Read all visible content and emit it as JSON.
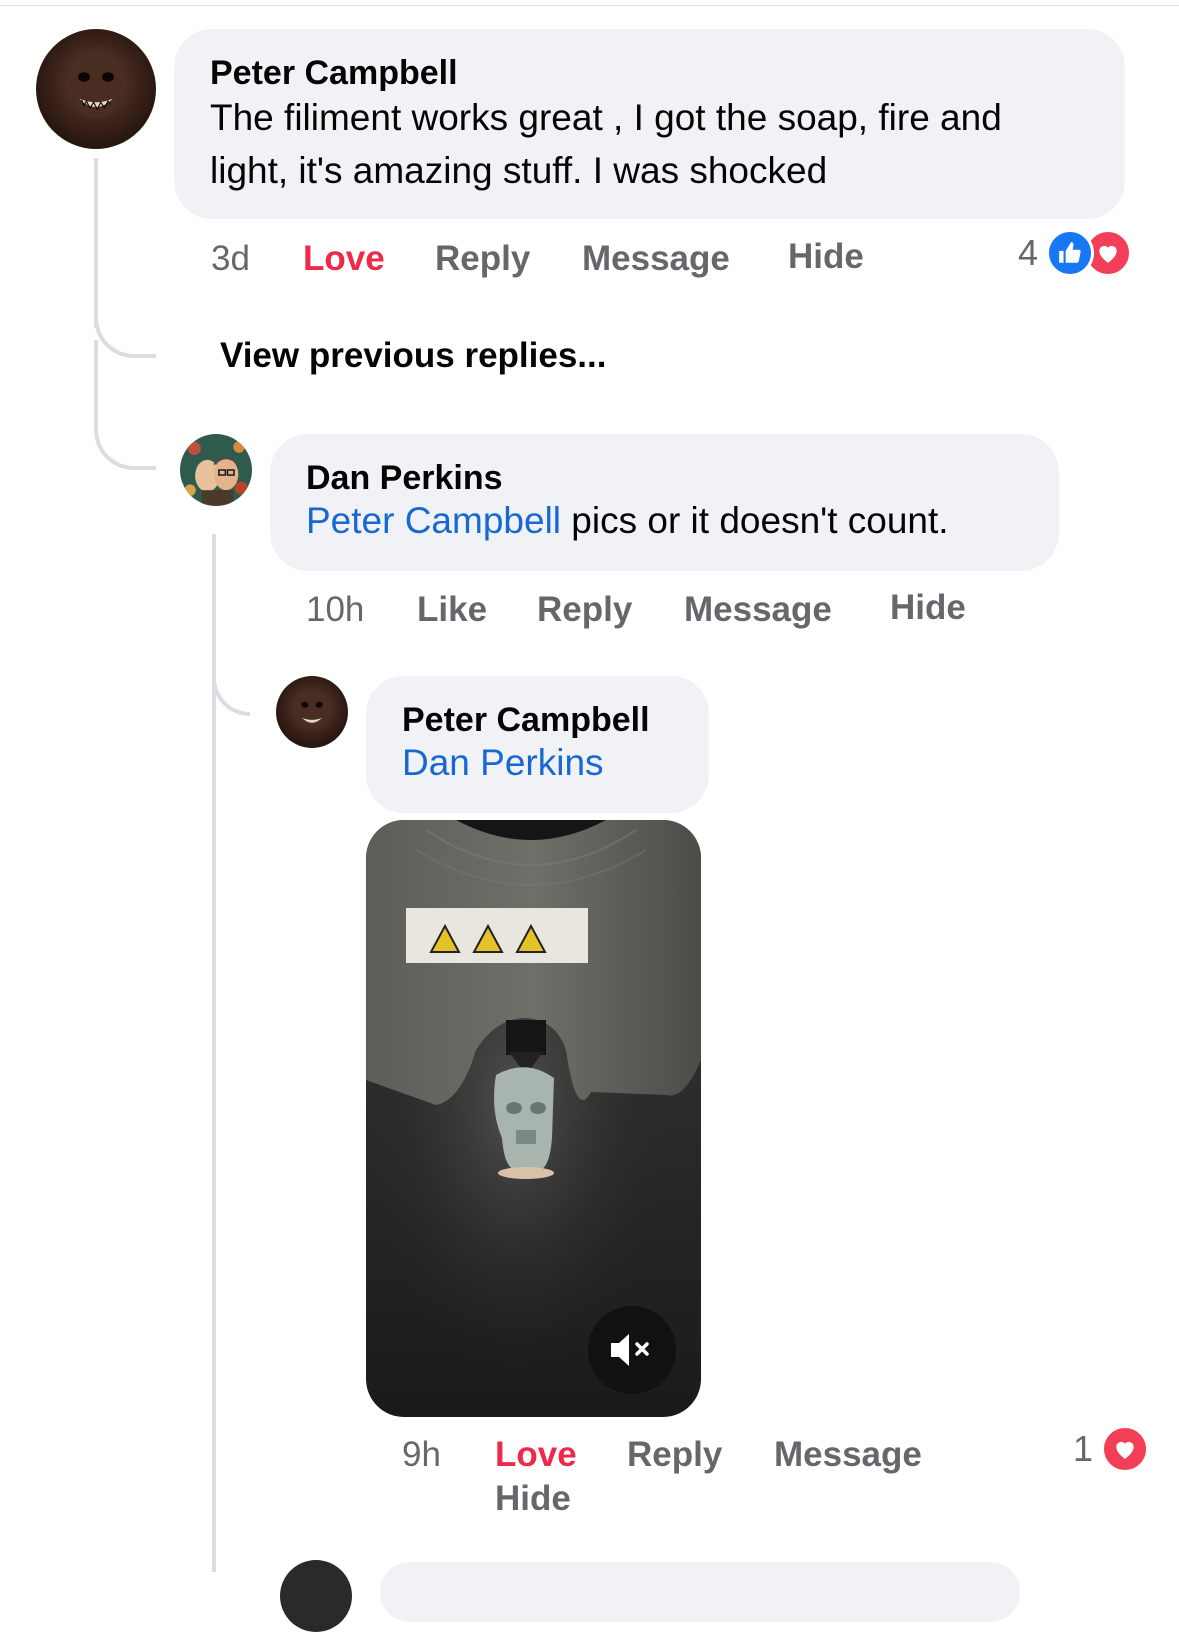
{
  "comment_1": {
    "author": "Peter Campbell",
    "text": "The filiment works great , I got the soap, fire and light, it's amazing stuff. I was shocked",
    "time": "3d",
    "love_label": "Love",
    "reply_label": "Reply",
    "message_label": "Message",
    "hide_label": "Hide",
    "reaction_count": "4"
  },
  "view_previous_label": "View previous replies...",
  "reply_1": {
    "author": "Dan Perkins",
    "mention": "Peter Campbell",
    "text": " pics or it doesn't count.",
    "time": "10h",
    "like_label": "Like",
    "reply_label": "Reply",
    "message_label": "Message",
    "hide_label": "Hide"
  },
  "reply_2": {
    "author": "Peter Campbell",
    "mention": "Dan Perkins",
    "time": "9h",
    "love_label": "Love",
    "reply_label": "Reply",
    "message_label": "Message",
    "hide_label": "Hide",
    "reaction_count": "1"
  },
  "colors": {
    "mention": "#1868d4",
    "love": "#f02849",
    "like_reaction": "#1877f2",
    "love_reaction": "#f33e58",
    "bubble": "#f0f2f5"
  },
  "icons": {
    "video_sound": "muted-speaker-icon"
  }
}
